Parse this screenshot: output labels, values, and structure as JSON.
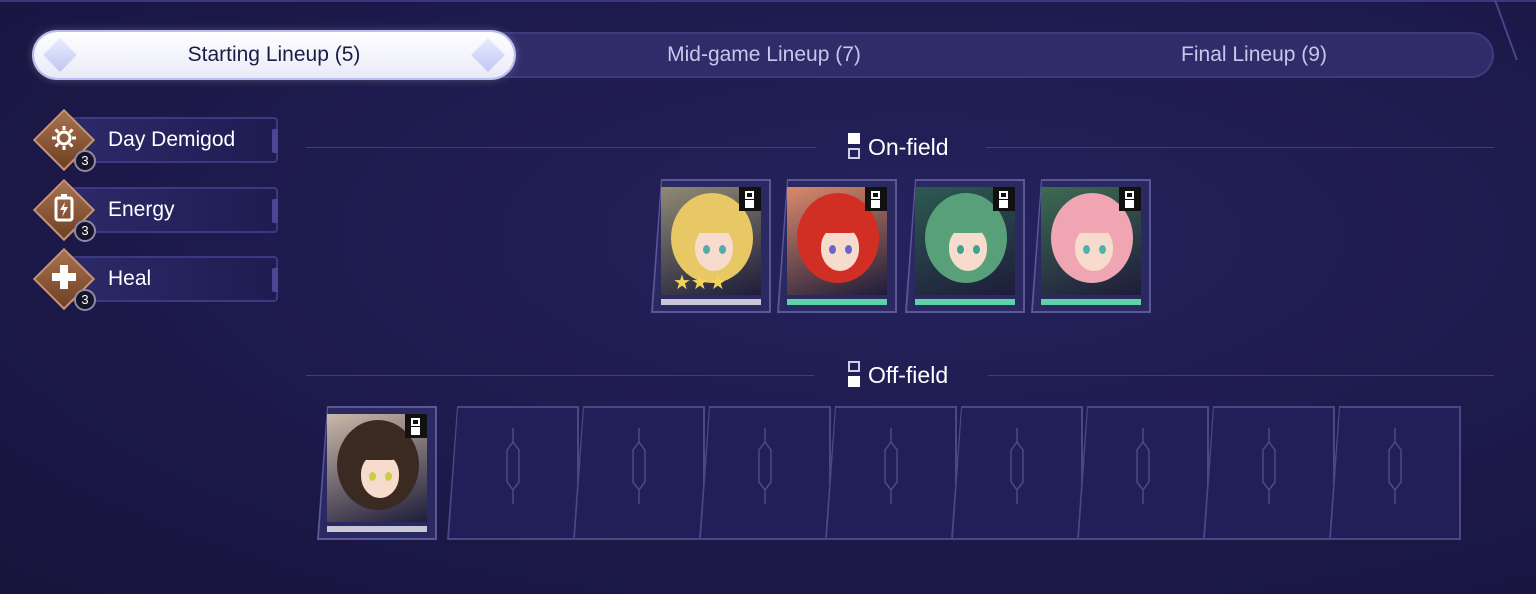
{
  "tabs": [
    {
      "label": "Starting Lineup (5)",
      "active": true
    },
    {
      "label": "Mid-game Lineup (7)",
      "active": false
    },
    {
      "label": "Final Lineup (9)",
      "active": false
    }
  ],
  "traits": [
    {
      "label": "Day Demigod",
      "count": "3",
      "icon": "sun-gear-icon"
    },
    {
      "label": "Energy",
      "count": "3",
      "icon": "battery-bolt-icon"
    },
    {
      "label": "Heal",
      "count": "3",
      "icon": "cross-icon"
    }
  ],
  "sections": {
    "on_field": "On-field",
    "off_field": "Off-field"
  },
  "on_field_cards": [
    {
      "hair": "#e7c865",
      "bg": "#8f8a73",
      "eye": "#5aa9a6",
      "bar": "#c9c7d6",
      "stars": "★★★"
    },
    {
      "hair": "#d22f24",
      "bg": "#d98a6a",
      "eye": "#6a67c9",
      "bar": "#5fd3a8",
      "stars": ""
    },
    {
      "hair": "#58a07a",
      "bg": "#2d5a50",
      "eye": "#3ea28e",
      "bar": "#5fd3a8",
      "stars": ""
    },
    {
      "hair": "#f0a6b2",
      "bg": "#3d6a54",
      "eye": "#4bb4a8",
      "bar": "#5fd3a8",
      "stars": ""
    }
  ],
  "off_field_cards": [
    {
      "hair": "#3a2a22",
      "bg": "#c9b9a8",
      "eye": "#c8d040",
      "bar": "#c9c7d6",
      "stars": ""
    }
  ],
  "empty_slots": 8
}
